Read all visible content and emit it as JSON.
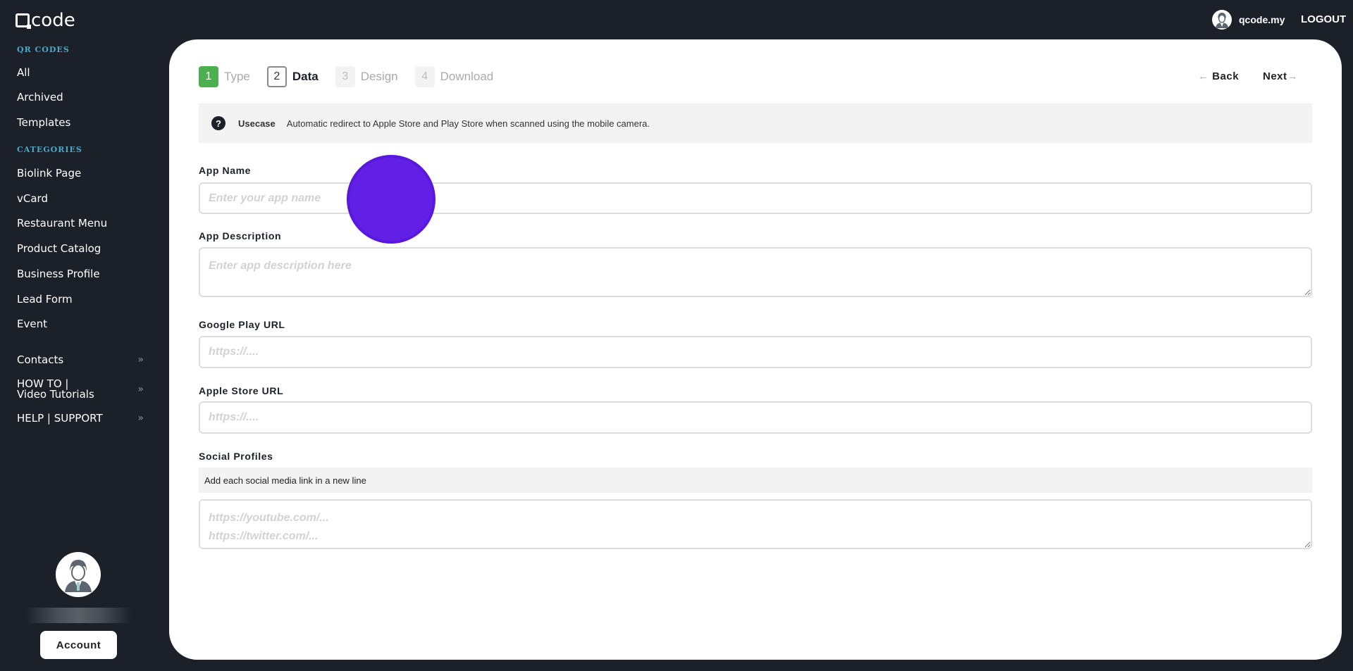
{
  "brand": {
    "logo_text": "code"
  },
  "sidebar": {
    "qr_section": "QR CODES",
    "qr_items": [
      "All",
      "Archived",
      "Templates"
    ],
    "cat_section": "CATEGORIES",
    "cat_items": [
      "Biolink Page",
      "vCard",
      "Restaurant Menu",
      "Product Catalog",
      "Business Profile",
      "Lead Form",
      "Event"
    ],
    "extra_items": [
      "Contacts",
      "HOW TO | Video Tutorials",
      "HELP | SUPPORT"
    ],
    "account_label": "Account"
  },
  "header": {
    "username": "qcode.my",
    "logout": "LOGOUT"
  },
  "wizard": {
    "steps": [
      {
        "num": "1",
        "label": "Type"
      },
      {
        "num": "2",
        "label": "Data"
      },
      {
        "num": "3",
        "label": "Design"
      },
      {
        "num": "4",
        "label": "Download"
      }
    ],
    "back": "Back",
    "next": "Next"
  },
  "usecase": {
    "title": "Usecase",
    "text": "Automatic redirect to Apple Store and Play Store when scanned using the mobile camera."
  },
  "form": {
    "app_name": {
      "label": "App Name",
      "placeholder": "Enter your app name"
    },
    "app_description": {
      "label": "App Description",
      "placeholder": "Enter app description here"
    },
    "google_play": {
      "label": "Google Play URL",
      "placeholder": "https://...."
    },
    "apple_store": {
      "label": "Apple Store URL",
      "placeholder": "https://...."
    },
    "social": {
      "label": "Social Profiles",
      "hint": "Add each social media link in a new line",
      "placeholder": "https://youtube.com/...\nhttps://twitter.com/...\nhttps://..."
    }
  },
  "colors": {
    "accent_green": "#4caf50",
    "cursor": "#6220e6",
    "bg": "#1b2029"
  }
}
